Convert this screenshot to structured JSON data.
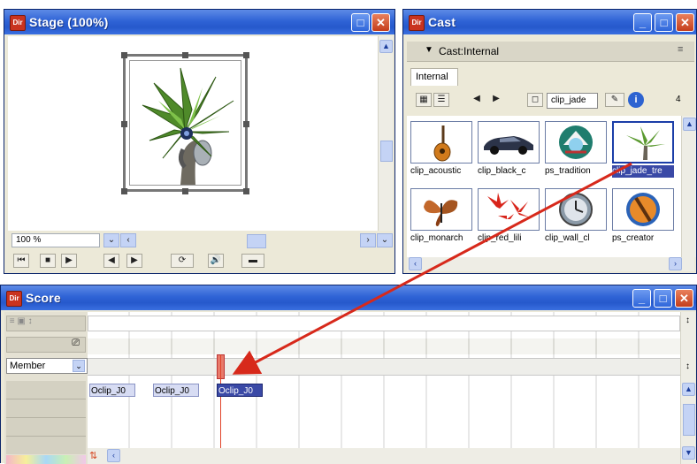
{
  "stage": {
    "title": "Stage (100%)",
    "zoom": "100 %",
    "controls": [
      "rewind-icon",
      "stop-icon",
      "play-icon",
      "step-back-icon",
      "step-forward-icon",
      "loop-icon",
      "volume-icon",
      "selected-frames-icon"
    ]
  },
  "cast": {
    "title": "Cast",
    "header": "Cast:Internal",
    "tab": "Internal",
    "member_field": "clip_jade",
    "members_row1": [
      "clip_acoustic",
      "clip_black_c",
      "ps_tradition",
      "clip_jade_tre"
    ],
    "members_row2": [
      "clip_monarch",
      "clip_red_lili",
      "clip_wall_cl",
      "ps_creator"
    ]
  },
  "score": {
    "title": "Score",
    "channel_dropdown": "Member",
    "sprites": [
      "Oclip_J0",
      "Oclip_J0",
      "Oclip_J0"
    ]
  },
  "colors": {
    "title_blue": "#2659cc",
    "close_red": "#c43d1b",
    "playhead": "#e0442a",
    "selected_sprite": "#3a49a6",
    "annotation_arrow": "#d7291b"
  }
}
